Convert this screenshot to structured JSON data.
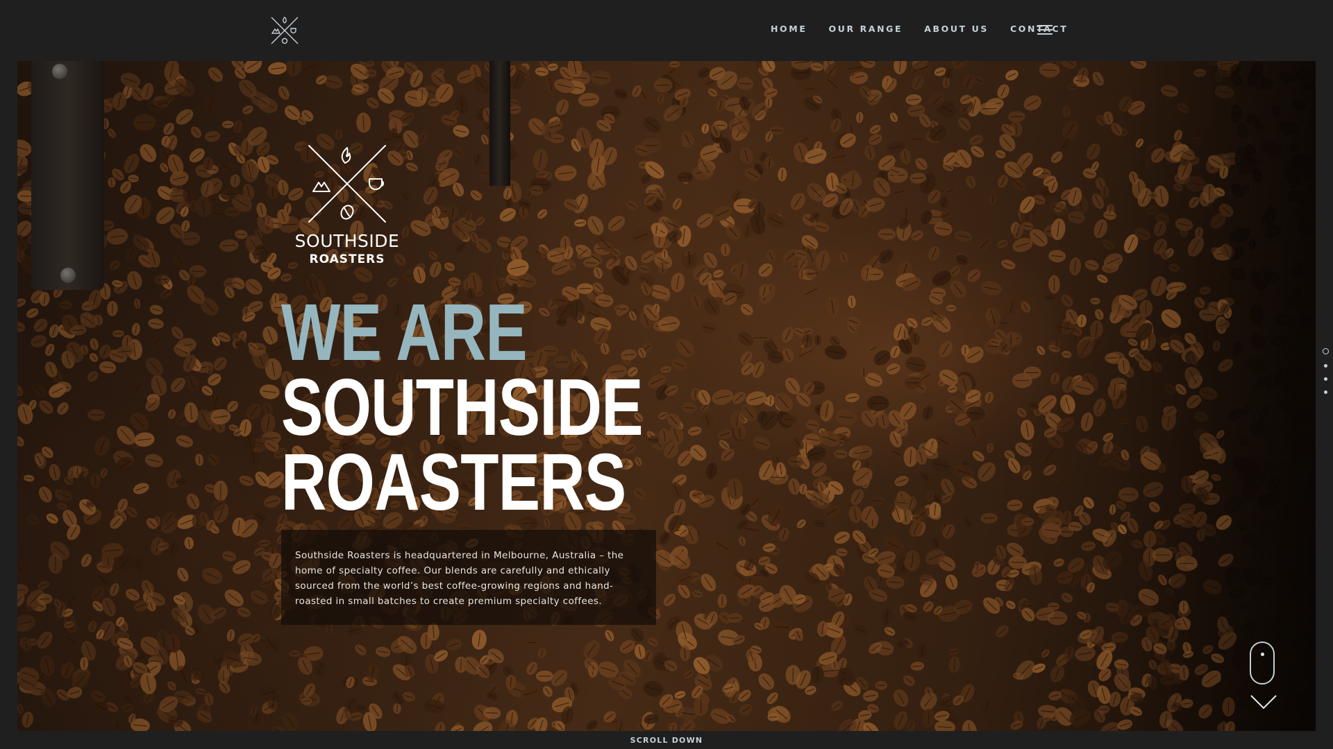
{
  "header": {
    "logo_icon": "crossed-lines-emblem-icon",
    "nav": [
      {
        "label": "HOME"
      },
      {
        "label": "OUR RANGE"
      },
      {
        "label": "ABOUT US"
      },
      {
        "label": "CONTACT"
      }
    ],
    "menu_icon": "hamburger-menu-icon"
  },
  "hero": {
    "background": "coffee beans roasting photo",
    "logo": {
      "icon": "crossed-lines-emblem-icon",
      "brand_line1": "SOUTHSIDE",
      "brand_line2": "ROASTERS"
    },
    "headline": {
      "line1": "WE ARE",
      "line2": "SOUTHSIDE",
      "line3": "ROASTERS"
    },
    "intro": "Southside Roasters is headquartered in Melbourne, Australia – the home of specialty coffee. Our blends are carefully and ethically sourced from the world’s best coffee-growing regions and hand-roasted in small batches to create premium specialty coffees.",
    "pagination": {
      "count": 4,
      "active": 1
    }
  },
  "scroll": {
    "label": "SCROLL DOWN",
    "mouse_icon": "mouse-scroll-icon",
    "chevron_icon": "chevron-down-icon"
  },
  "colors": {
    "background": "#1f1f20",
    "accent": "#96b6bf",
    "nav_text": "#c7d0d4",
    "white": "#ffffff"
  }
}
